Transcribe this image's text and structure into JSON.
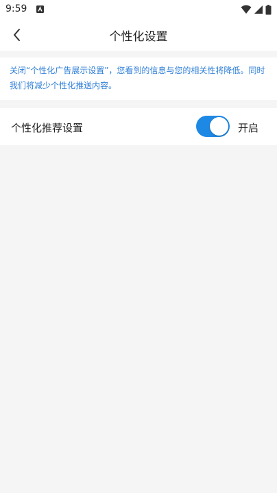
{
  "status_bar": {
    "time": "9:59",
    "icons": [
      "notification-a-icon",
      "wifi-icon",
      "signal-icon",
      "battery-icon"
    ]
  },
  "header": {
    "title": "个性化设置",
    "back_icon": "back-arrow-icon"
  },
  "notice": {
    "text": "关闭“个性化广告展示设置”，您看到的信息与您的相关性将降低。同时我们将减少个性化推送内容。",
    "color": "#2f7fd8"
  },
  "settings": {
    "personalized_recommendation": {
      "label": "个性化推荐设置",
      "state_label": "开启",
      "enabled": true,
      "accent_color": "#1e88e5"
    }
  }
}
